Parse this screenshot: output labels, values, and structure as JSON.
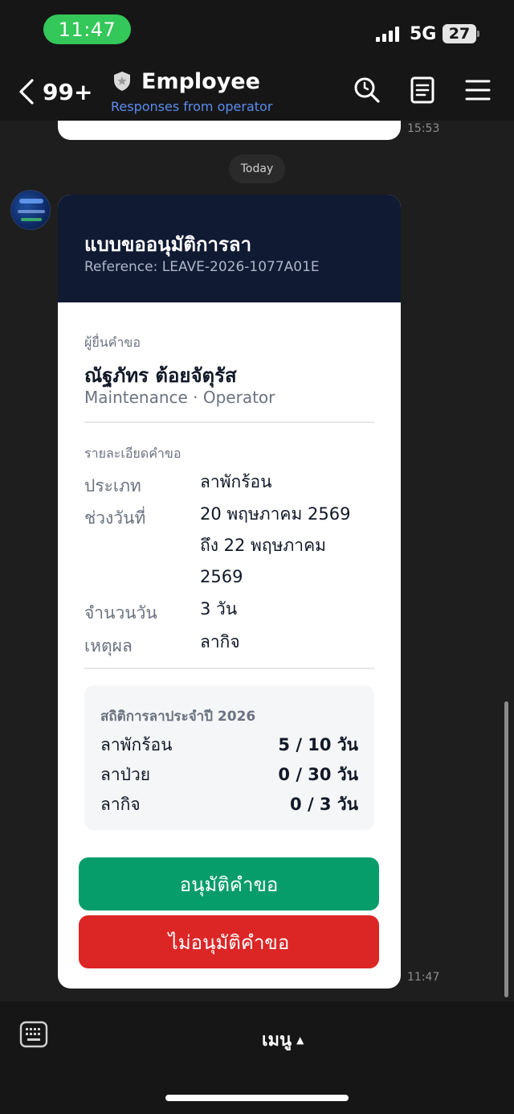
{
  "status_bar": {
    "time": "11:47",
    "network": "5G",
    "battery": "27"
  },
  "header": {
    "unread_count": "99+",
    "title": "Employee",
    "subtitle": "Responses from operator"
  },
  "chat": {
    "prev_time": "15:53",
    "date_chip": "Today",
    "card": {
      "title": "แบบขออนุมัติการลา",
      "reference": "Reference: LEAVE-2026-1077A01E",
      "requester_label": "ผู้ยื่นคำขอ",
      "requester_name": "ณัฐภัทร ต้อยจัตุรัส",
      "requester_dept": "Maintenance · Operator",
      "details_label": "รายละเอียดคำขอ",
      "details": [
        {
          "key": "ประเภท",
          "value": "ลาพักร้อน"
        },
        {
          "key": "ช่วงวันที่",
          "value_lines": [
            "20 พฤษภาคม 2569",
            "ถึง 22 พฤษภาคม",
            "2569"
          ]
        },
        {
          "key": "จำนวนวัน",
          "value": "3 วัน"
        },
        {
          "key": "เหตุผล",
          "value": "ลากิจ"
        }
      ],
      "stats_title": "สถิติการลาประจำปี 2026",
      "stats": [
        {
          "name": "ลาพักร้อน",
          "value": "5 / 10 วัน"
        },
        {
          "name": "ลาป่วย",
          "value": "0 / 30 วัน"
        },
        {
          "name": "ลากิจ",
          "value": "0 / 3 วัน"
        }
      ],
      "approve_label": "อนุมัติคำขอ",
      "reject_label": "ไม่อนุมัติคำขอ"
    },
    "msg_time": "11:47"
  },
  "bottom": {
    "menu_label": "เมนู"
  },
  "colors": {
    "approve": "#079d6b",
    "reject": "#dc2626",
    "time_pill": "#34c759",
    "card_header": "#101a33",
    "subtitle": "#5b8def"
  },
  "icons": [
    "back-icon",
    "shield-icon",
    "search-icon",
    "notes-icon",
    "menu-icon",
    "keyboard-icon",
    "caret-up-icon"
  ]
}
